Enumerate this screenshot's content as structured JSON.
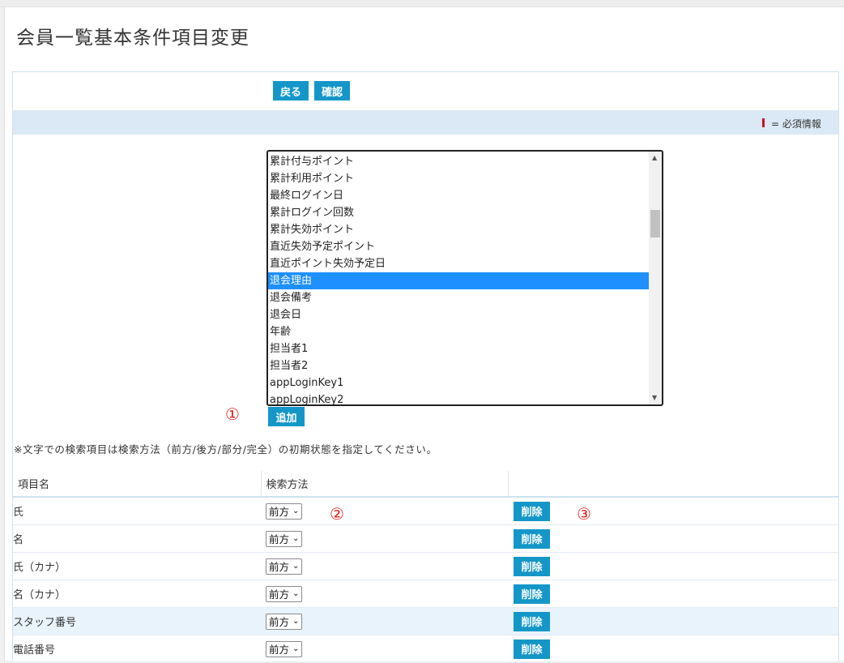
{
  "page": {
    "title": "会員一覧基本条件項目変更"
  },
  "toolbar": {
    "back_label": "戻る",
    "confirm_label": "確認"
  },
  "required_legend": {
    "text": "= 必須情報",
    "mark_color": "#cc1122"
  },
  "listbox": {
    "options": [
      "累計付与ポイント",
      "累計利用ポイント",
      "最終ログイン日",
      "累計ログイン回数",
      "累計失効ポイント",
      "直近失効予定ポイント",
      "直近ポイント失効予定日",
      "退会理由",
      "退会備考",
      "退会日",
      "年齢",
      "担当者1",
      "担当者2",
      "appLoginKey1",
      "appLoginKey2"
    ],
    "selected": "退会理由"
  },
  "add_label": "追加",
  "annotations": {
    "one": "①",
    "two": "②",
    "three": "③"
  },
  "note": "※文字での検索項目は検索方法（前方/後方/部分/完全）の初期状態を指定してください。",
  "table": {
    "headers": [
      "項目名",
      "検索方法",
      ""
    ],
    "rows": [
      {
        "name": "氏",
        "method": "前方",
        "delete": "削除"
      },
      {
        "name": "名",
        "method": "前方",
        "delete": "削除"
      },
      {
        "name": "氏（カナ）",
        "method": "前方",
        "delete": "削除"
      },
      {
        "name": "名（カナ）",
        "method": "前方",
        "delete": "削除"
      },
      {
        "name": "スタッフ番号",
        "method": "前方",
        "delete": "削除",
        "highlighted": true
      },
      {
        "name": "電話番号",
        "method": "前方",
        "delete": "削除"
      }
    ]
  },
  "colors": {
    "accent": "#1497c8",
    "selection": "#1e90ff",
    "legend_bar": "#dbe9f6",
    "annotation": "#e02020"
  }
}
